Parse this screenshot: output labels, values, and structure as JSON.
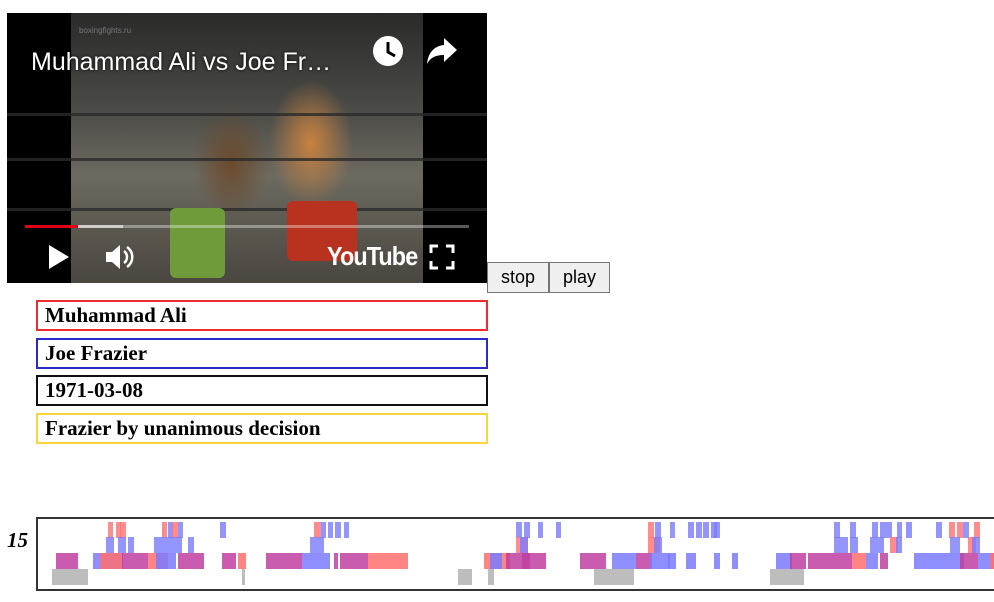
{
  "video": {
    "title": "Muhammad Ali vs Joe Fr…",
    "watermark": "boxingfights.ru",
    "logo_text": "YouTube",
    "progress_played": 0.12,
    "progress_loaded": 0.22,
    "icons": [
      "clock-icon",
      "share-icon",
      "play-icon",
      "volume-icon",
      "fullscreen-icon"
    ]
  },
  "controls": {
    "stop_label": "stop",
    "play_label": "play"
  },
  "info": {
    "fighter_red": "Muhammad Ali",
    "fighter_blue": "Joe Frazier",
    "date": "1971-03-08",
    "result": "Frazier by unanimous decision"
  },
  "timeline": {
    "round_label": "15",
    "colors": {
      "red": "#ff7070",
      "blue": "#7a7aff",
      "gray": "#bdbdbd",
      "overlap": "#c040a0"
    }
  }
}
